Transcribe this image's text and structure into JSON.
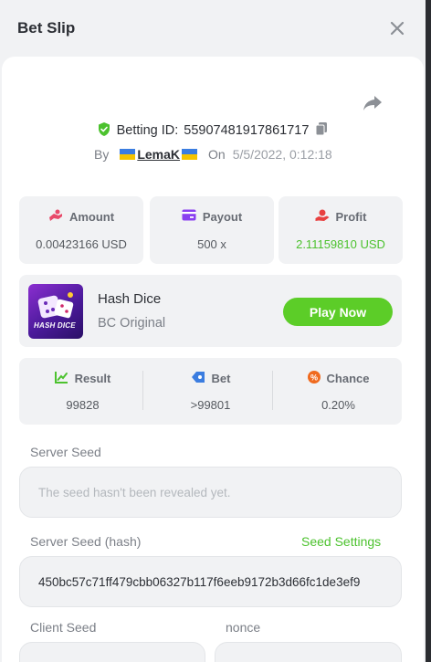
{
  "header": {
    "title": "Bet Slip"
  },
  "bet": {
    "id_label": "Betting ID:",
    "id_value": "55907481917861717",
    "by_label": "By",
    "username": "LemaK",
    "on_label": "On",
    "date": "5/5/2022, 0:12:18"
  },
  "stats": {
    "amount_label": "Amount",
    "amount_value": "0.00423166 USD",
    "payout_label": "Payout",
    "payout_value": "500 x",
    "profit_label": "Profit",
    "profit_value": "2.11159810 USD"
  },
  "game": {
    "name": "Hash Dice",
    "sub": "BC Original",
    "thumb_text": "HASH DICE",
    "play_label": "Play Now"
  },
  "result": {
    "result_label": "Result",
    "result_value": "99828",
    "bet_label": "Bet",
    "bet_value": ">99801",
    "chance_label": "Chance",
    "chance_value": "0.20%"
  },
  "seeds": {
    "server_seed_label": "Server Seed",
    "server_seed_placeholder": "The seed hasn't been revealed yet.",
    "server_hash_label": "Server Seed (hash)",
    "seed_settings_label": "Seed Settings",
    "server_hash_value": "450bc57c71ff479cbb06327b117f6eeb9172b3d66fc1de3ef9",
    "client_seed_label": "Client Seed",
    "nonce_label": "nonce"
  },
  "colors": {
    "accent_green": "#5ccd28",
    "profit_green": "#4cc22e",
    "amount_icon": "#e84a6a",
    "payout_icon": "#8a3ff0",
    "profit_icon": "#e84040",
    "result_icon": "#4cc22e",
    "bet_icon": "#3b7de0",
    "chance_icon": "#f06a1e"
  }
}
